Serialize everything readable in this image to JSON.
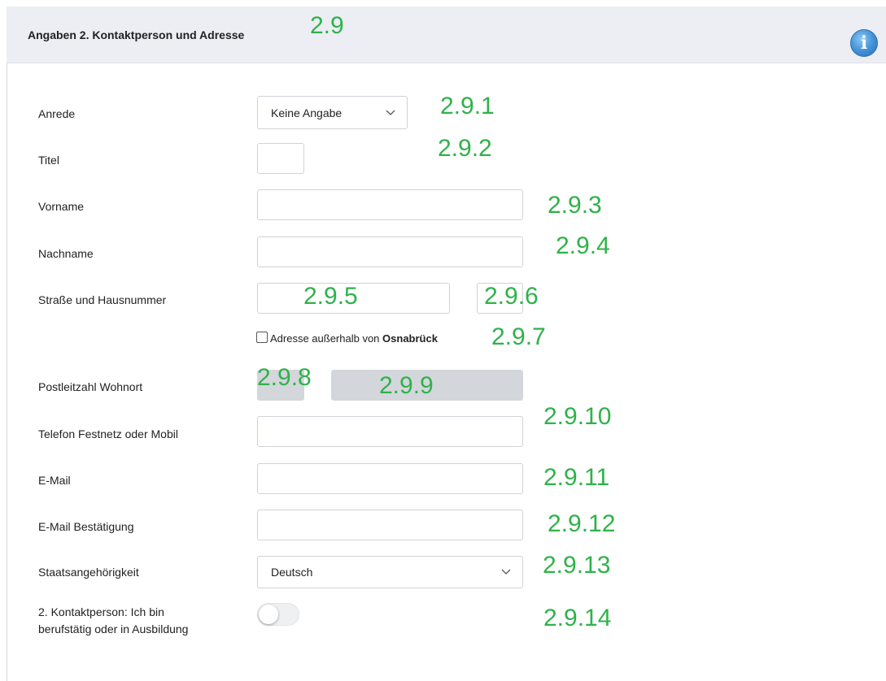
{
  "section": {
    "title": "Angaben 2. Kontaktperson und Adresse",
    "info_icon": "info-icon"
  },
  "annotations": {
    "a2_9": "2.9",
    "a2_9_1": "2.9.1",
    "a2_9_2": "2.9.2",
    "a2_9_3": "2.9.3",
    "a2_9_4": "2.9.4",
    "a2_9_5": "2.9.5",
    "a2_9_6": "2.9.6",
    "a2_9_7": "2.9.7",
    "a2_9_8": "2.9.8",
    "a2_9_9": "2.9.9",
    "a2_9_10": "2.9.10",
    "a2_9_11": "2.9.11",
    "a2_9_12": "2.9.12",
    "a2_9_13": "2.9.13",
    "a2_9_14": "2.9.14",
    "color": "#2fb24a"
  },
  "form": {
    "anrede": {
      "label": "Anrede",
      "value": "Keine Angabe"
    },
    "titel": {
      "label": "Titel",
      "value": ""
    },
    "vorname": {
      "label": "Vorname",
      "value": ""
    },
    "nachname": {
      "label": "Nachname",
      "value": ""
    },
    "strasse": {
      "label": "Straße und Hausnummer",
      "street_value": "",
      "number_value": ""
    },
    "outside": {
      "label_prefix": "Adresse außerhalb von",
      "label_city": "Osnabrück",
      "checked": false
    },
    "plz": {
      "label": "Postleitzahl Wohnort",
      "plz_value": "",
      "ort_value": ""
    },
    "telefon": {
      "label": "Telefon Festnetz oder Mobil",
      "value": ""
    },
    "email": {
      "label": "E-Mail",
      "value": ""
    },
    "email_confirm": {
      "label": "E-Mail Bestätigung",
      "value": ""
    },
    "staatsangehoerigkeit": {
      "label": "Staatsangehörigkeit",
      "value": "Deutsch"
    },
    "berufstaetig": {
      "label_line1": "2. Kontaktperson: Ich bin",
      "label_line2": "berufstätig oder in Ausbildung",
      "on": false
    }
  },
  "colors": {
    "header_bg": "#eceef4",
    "disabled_bg": "#d3d7db",
    "border": "#cfd3d8"
  }
}
